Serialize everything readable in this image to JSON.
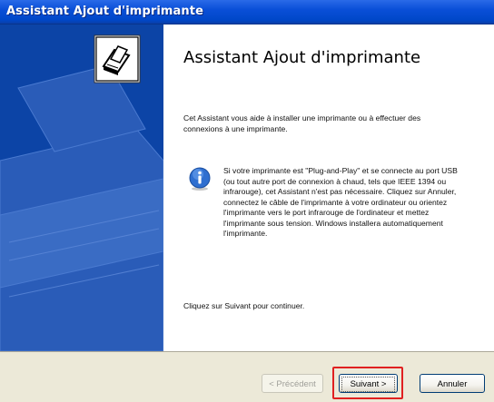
{
  "window": {
    "title": "Assistant Ajout d'imprimante"
  },
  "content": {
    "heading": "Assistant Ajout d'imprimante",
    "intro": "Cet Assistant vous aide à installer une imprimante ou à effectuer des connexions à une imprimante.",
    "info": "Si votre imprimante est \"Plug-and-Play\" et se connecte au port USB (ou tout autre port de connexion à chaud, tels que IEEE 1394 ou infrarouge), cet Assistant n'est pas nécessaire. Cliquez sur Annuler, connectez le câble de l'imprimante à votre ordinateur ou orientez l'imprimante vers le port infrarouge de l'ordinateur et mettez l'imprimante sous tension. Windows installera automatiquement l'imprimante.",
    "footer": "Cliquez sur Suivant pour continuer."
  },
  "buttons": {
    "previous": "< Précédent",
    "next": "Suivant >",
    "cancel": "Annuler"
  },
  "icons": {
    "sidebar": "printer-icon",
    "info": "info-icon"
  },
  "colors": {
    "titlebar": "#0a4fd8",
    "sidebar": "#0c44a6",
    "highlight": "#e02020"
  }
}
